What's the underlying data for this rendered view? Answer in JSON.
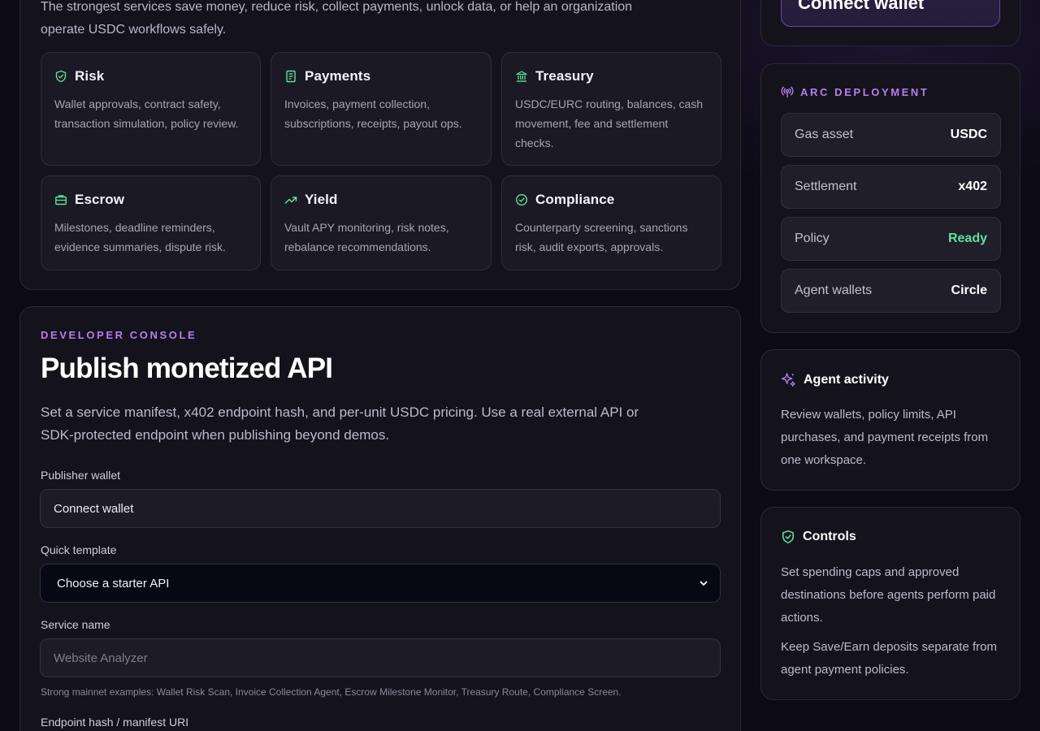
{
  "services": {
    "intro": "The strongest services save money, reduce risk, collect payments, unlock data, or help an organization operate USDC workflows safely.",
    "cards": [
      {
        "title": "Risk",
        "icon": "shield-check-icon",
        "desc": "Wallet approvals, contract safety, transaction simulation, policy review."
      },
      {
        "title": "Payments",
        "icon": "receipt-icon",
        "desc": "Invoices, payment collection, subscriptions, receipts, payout ops."
      },
      {
        "title": "Treasury",
        "icon": "bank-icon",
        "desc": "USDC/EURC routing, balances, cash movement, fee and settlement checks."
      },
      {
        "title": "Escrow",
        "icon": "briefcase-icon",
        "desc": "Milestones, deadline reminders, evidence summaries, dispute risk."
      },
      {
        "title": "Yield",
        "icon": "trending-up-icon",
        "desc": "Vault APY monitoring, risk notes, rebalance recommendations."
      },
      {
        "title": "Compliance",
        "icon": "badge-check-icon",
        "desc": "Counterparty screening, sanctions risk, audit exports, approvals."
      }
    ]
  },
  "developer_console": {
    "eyebrow": "DEVELOPER CONSOLE",
    "title": "Publish monetized API",
    "description": "Set a service manifest, x402 endpoint hash, and per-unit USDC pricing. Use a real external API or SDK-protected endpoint when publishing beyond demos.",
    "publisher_wallet": {
      "label": "Publisher wallet",
      "value": "Connect wallet"
    },
    "quick_template": {
      "label": "Quick template",
      "selected": "Choose a starter API"
    },
    "service_name": {
      "label": "Service name",
      "placeholder": "Website Analyzer",
      "hint": "Strong mainnet examples: Wallet Risk Scan, Invoice Collection Agent, Escrow Milestone Monitor, Treasury Route, Compliance Screen."
    },
    "endpoint": {
      "label": "Endpoint hash / manifest URI"
    }
  },
  "sidebar": {
    "connect_label": "Connect wallet",
    "arc": {
      "heading": "ARC DEPLOYMENT",
      "rows": [
        {
          "key": "Gas asset",
          "value": "USDC"
        },
        {
          "key": "Settlement",
          "value": "x402"
        },
        {
          "key": "Policy",
          "value": "Ready",
          "status": "ok"
        },
        {
          "key": "Agent wallets",
          "value": "Circle"
        }
      ]
    },
    "activity": {
      "title": "Agent activity",
      "text": "Review wallets, policy limits, API purchases, and payment receipts from one workspace."
    },
    "controls": {
      "title": "Controls",
      "text1": "Set spending caps and approved destinations before agents perform paid actions.",
      "text2": "Keep Save/Earn deposits separate from agent payment policies."
    }
  },
  "colors": {
    "accent": "#b77df0",
    "success": "#5ee0a0",
    "background": "#0c0b14",
    "panel": "#14131c"
  }
}
